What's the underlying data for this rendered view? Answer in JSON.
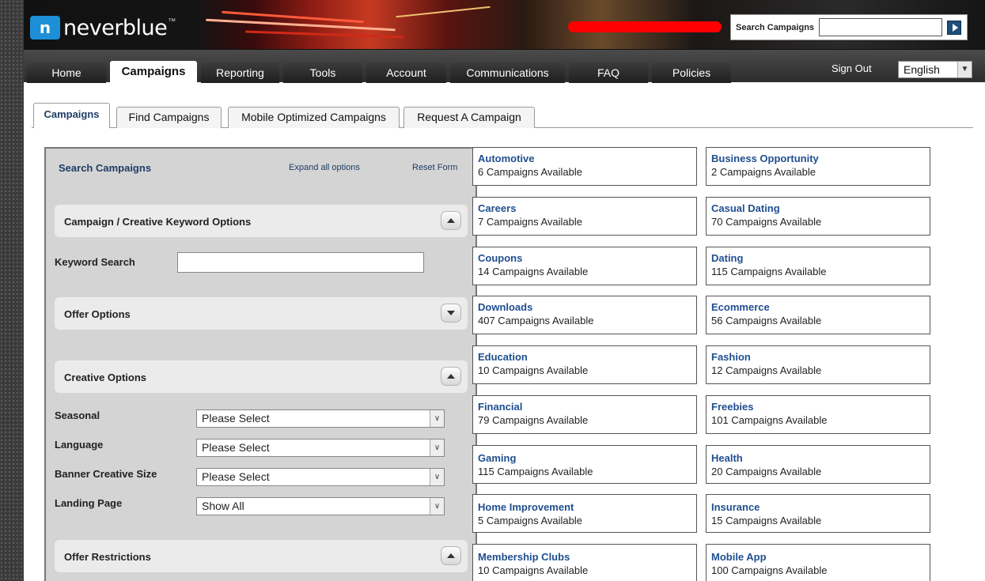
{
  "brand": {
    "logo_mark": "n",
    "logo_text": "neverblue",
    "logo_tm": "™"
  },
  "header": {
    "search_label": "Search Campaigns",
    "search_value": "",
    "go_icon": "play-arrow-icon"
  },
  "nav": {
    "tabs": [
      {
        "label": "Home"
      },
      {
        "label": "Campaigns"
      },
      {
        "label": "Reporting"
      },
      {
        "label": "Tools"
      },
      {
        "label": "Account"
      },
      {
        "label": "Communications"
      },
      {
        "label": "FAQ"
      },
      {
        "label": "Policies"
      }
    ],
    "active": "Campaigns",
    "sign_out": "Sign Out",
    "language": "English"
  },
  "subtabs": {
    "items": [
      {
        "label": "Campaigns"
      },
      {
        "label": "Find Campaigns"
      },
      {
        "label": "Mobile Optimized Campaigns"
      },
      {
        "label": "Request A Campaign"
      }
    ],
    "active": "Campaigns"
  },
  "search_panel": {
    "title": "Search Campaigns",
    "expand_all": "Expand all options",
    "reset": "Reset Form",
    "sections": {
      "keyword": "Campaign / Creative Keyword Options",
      "offer": "Offer Options",
      "creative": "Creative Options",
      "restrictions": "Offer Restrictions"
    },
    "keyword_label": "Keyword Search",
    "keyword_value": "",
    "fields": [
      {
        "label": "Seasonal",
        "value": "Please Select"
      },
      {
        "label": "Language",
        "value": "Please Select"
      },
      {
        "label": "Banner Creative Size",
        "value": "Please Select"
      },
      {
        "label": "Landing Page",
        "value": "Show All"
      }
    ]
  },
  "categories": [
    {
      "name": "Automotive",
      "count": "6 Campaigns Available"
    },
    {
      "name": "Business Opportunity",
      "count": "2 Campaigns Available"
    },
    {
      "name": "Careers",
      "count": "7 Campaigns Available"
    },
    {
      "name": "Casual Dating",
      "count": "70 Campaigns Available"
    },
    {
      "name": "Coupons",
      "count": "14 Campaigns Available"
    },
    {
      "name": "Dating",
      "count": "115 Campaigns Available"
    },
    {
      "name": "Downloads",
      "count": "407 Campaigns Available"
    },
    {
      "name": "Ecommerce",
      "count": "56 Campaigns Available"
    },
    {
      "name": "Education",
      "count": "10 Campaigns Available"
    },
    {
      "name": "Fashion",
      "count": "12 Campaigns Available"
    },
    {
      "name": "Financial",
      "count": "79 Campaigns Available"
    },
    {
      "name": "Freebies",
      "count": "101 Campaigns Available"
    },
    {
      "name": "Gaming",
      "count": "115 Campaigns Available"
    },
    {
      "name": "Health",
      "count": "20 Campaigns Available"
    },
    {
      "name": "Home Improvement",
      "count": "5 Campaigns Available"
    },
    {
      "name": "Insurance",
      "count": "15 Campaigns Available"
    },
    {
      "name": "Membership Clubs",
      "count": "10 Campaigns Available"
    },
    {
      "name": "Mobile App",
      "count": "100 Campaigns Available"
    }
  ],
  "colors": {
    "link": "#1f4f8f",
    "panel_bg": "#d4d4d4",
    "redaction": "#ff0000"
  }
}
